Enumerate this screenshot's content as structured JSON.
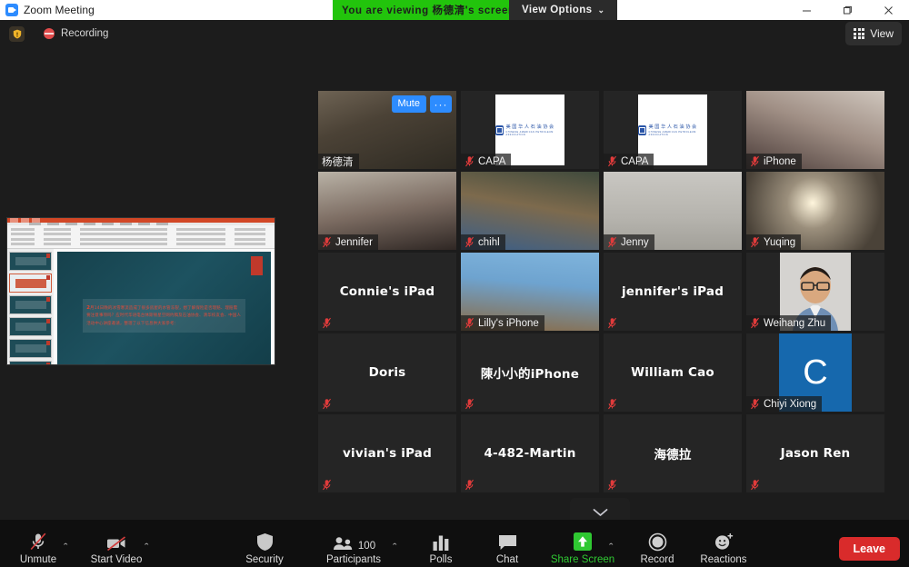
{
  "window": {
    "app_title": "Zoom Meeting",
    "logo_icon": "zoom-logo-icon",
    "minimize_icon": "minimize-icon",
    "maximize_icon": "maximize-icon",
    "close_icon": "close-icon"
  },
  "sharing": {
    "banner_text": "You are viewing 杨德清's screen",
    "view_options_label": "View Options",
    "view_options_caret": "⌄",
    "banner_color": "#22c40c"
  },
  "subheader": {
    "shield_icon": "shield-icon",
    "recording_label": "Recording",
    "recording_icon": "recording-icon",
    "view_label": "View",
    "view_icon": "grid-view-icon"
  },
  "shared_screen": {
    "app": "PowerPoint",
    "slide_text_lead": "2",
    "slide_text": "月14日晚的冰雪寒流造成了很多房屋的水管冻裂，想了解保险是否理赔、理赔需要注意事项吗？应时代华语电台休斯顿星空网约稿及石油协会、清华校友会、中国人活动中心讲座邀请，整理了以下信息供大家参考：",
    "thumbnail_count": 6,
    "selected_thumbnail": 2
  },
  "gallery": {
    "mute_button_label": "Mute",
    "more_button_label": "···",
    "collapse_icon": "chevron-down-icon",
    "mic_off_icon": "mic-off-icon",
    "participants": [
      {
        "name": "杨德清",
        "type": "video",
        "active": true,
        "name_position": "bar",
        "mic_muted": false,
        "show_controls": true
      },
      {
        "name": "CAPA",
        "type": "logo",
        "active": false,
        "name_position": "bar",
        "mic_muted": true
      },
      {
        "name": "CAPA",
        "type": "logo",
        "active": false,
        "name_position": "bar",
        "mic_muted": true
      },
      {
        "name": "iPhone",
        "type": "video",
        "active": false,
        "name_position": "bar",
        "mic_muted": true
      },
      {
        "name": "Jennifer",
        "type": "video",
        "active": false,
        "name_position": "bar",
        "mic_muted": true
      },
      {
        "name": "chihl",
        "type": "video",
        "active": false,
        "name_position": "bar",
        "mic_muted": true
      },
      {
        "name": "Jenny",
        "type": "video",
        "active": false,
        "name_position": "bar",
        "mic_muted": true
      },
      {
        "name": "Yuqing",
        "type": "video",
        "active": false,
        "name_position": "bar",
        "mic_muted": true
      },
      {
        "name": "Connie's iPad",
        "type": "novideo",
        "active": false,
        "name_position": "center",
        "mic_muted": true
      },
      {
        "name": "Lilly's iPhone",
        "type": "video",
        "active": false,
        "name_position": "bar",
        "mic_muted": true
      },
      {
        "name": "jennifer's iPad",
        "type": "novideo",
        "active": false,
        "name_position": "center",
        "mic_muted": true
      },
      {
        "name": "Weihang Zhu",
        "type": "photo",
        "active": false,
        "name_position": "bar",
        "mic_muted": true
      },
      {
        "name": "Doris",
        "type": "novideo",
        "active": false,
        "name_position": "center",
        "mic_muted": true
      },
      {
        "name": "陳小小的iPhone",
        "type": "novideo",
        "active": false,
        "name_position": "center",
        "mic_muted": true
      },
      {
        "name": "William Cao",
        "type": "novideo",
        "active": false,
        "name_position": "center",
        "mic_muted": true
      },
      {
        "name": "Chiyi Xiong",
        "type": "avatar",
        "avatar_letter": "C",
        "avatar_color": "#1668ad",
        "active": false,
        "name_position": "bar",
        "mic_muted": true
      },
      {
        "name": "vivian's iPad",
        "type": "novideo",
        "active": false,
        "name_position": "center",
        "mic_muted": true
      },
      {
        "name": "4-482-Martin",
        "type": "novideo",
        "active": false,
        "name_position": "center",
        "mic_muted": true
      },
      {
        "name": "海德拉",
        "type": "novideo",
        "active": false,
        "name_position": "center",
        "mic_muted": true
      },
      {
        "name": "Jason Ren",
        "type": "novideo",
        "active": false,
        "name_position": "center",
        "mic_muted": true
      }
    ]
  },
  "toolbar": {
    "unmute_label": "Unmute",
    "unmute_icon": "mic-off-icon",
    "start_video_label": "Start Video",
    "start_video_icon": "video-off-icon",
    "security_label": "Security",
    "security_icon": "shield-icon",
    "participants_label": "Participants",
    "participants_icon": "people-icon",
    "participants_count": "100",
    "polls_label": "Polls",
    "polls_icon": "bar-chart-icon",
    "chat_label": "Chat",
    "chat_icon": "chat-bubble-icon",
    "share_screen_label": "Share Screen",
    "share_screen_icon": "share-screen-icon",
    "share_screen_color": "#2fc832",
    "record_label": "Record",
    "record_icon": "record-circle-icon",
    "reactions_label": "Reactions",
    "reactions_icon": "smiley-plus-icon",
    "leave_label": "Leave",
    "leave_color": "#d92b2b",
    "caret": "⌃"
  }
}
